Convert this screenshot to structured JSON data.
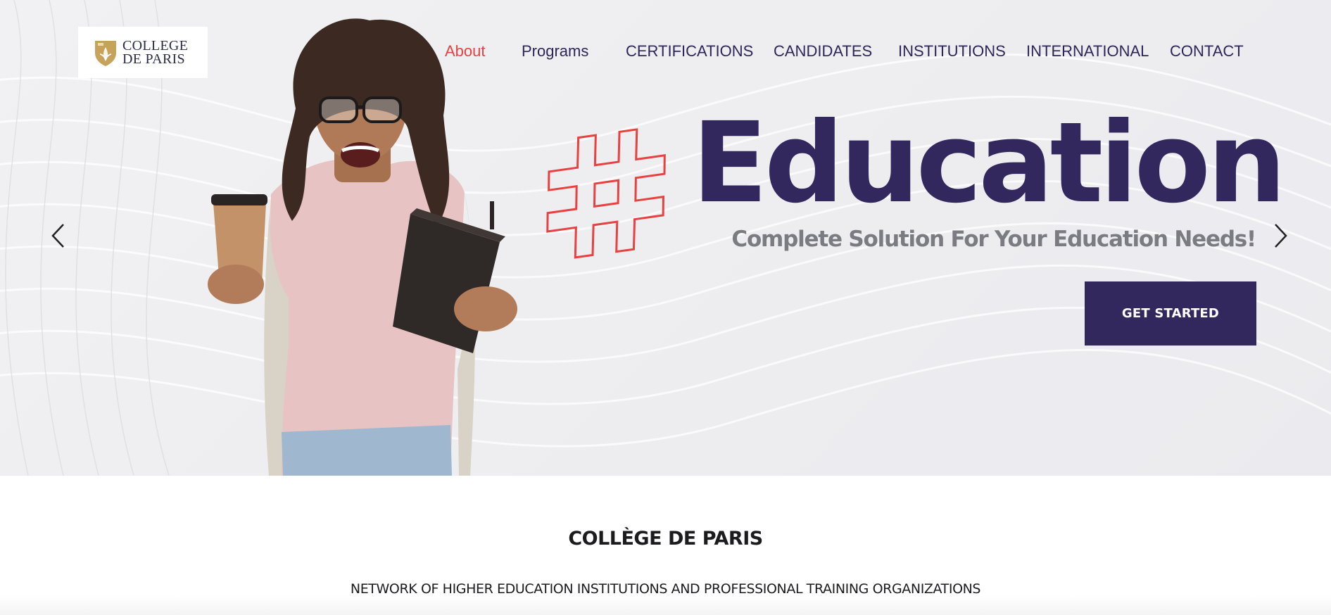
{
  "brand": {
    "logo_line1": "COLLEGE",
    "logo_line2": "DE PARIS",
    "logo_gold": "#c7a35a",
    "logo_navy": "#2c2a4a"
  },
  "nav": {
    "items": [
      {
        "label": "About",
        "active": true
      },
      {
        "label": "Programs",
        "active": false
      },
      {
        "label": "CERTIFICATIONS",
        "active": false
      },
      {
        "label": "CANDIDATES",
        "active": false
      },
      {
        "label": "INSTITUTIONS",
        "active": false
      },
      {
        "label": "INTERNATIONAL",
        "active": false
      },
      {
        "label": "CONTACT",
        "active": false
      }
    ],
    "active_color": "#e84141",
    "text_color": "#2e2657"
  },
  "hero": {
    "hashtag_icon": "hashtag-icon",
    "headline": "Education",
    "subline": "Complete Solution For Your Education Needs!",
    "cta_label": "GET STARTED",
    "prev_icon": "chevron-left-icon",
    "next_icon": "chevron-right-icon",
    "accent_color": "#32285e",
    "hashtag_color": "#e84141"
  },
  "intro": {
    "title": "COLLÈGE DE PARIS",
    "subtitle": "NETWORK OF HIGHER EDUCATION INSTITUTIONS AND PROFESSIONAL TRAINING ORGANIZATIONS"
  }
}
